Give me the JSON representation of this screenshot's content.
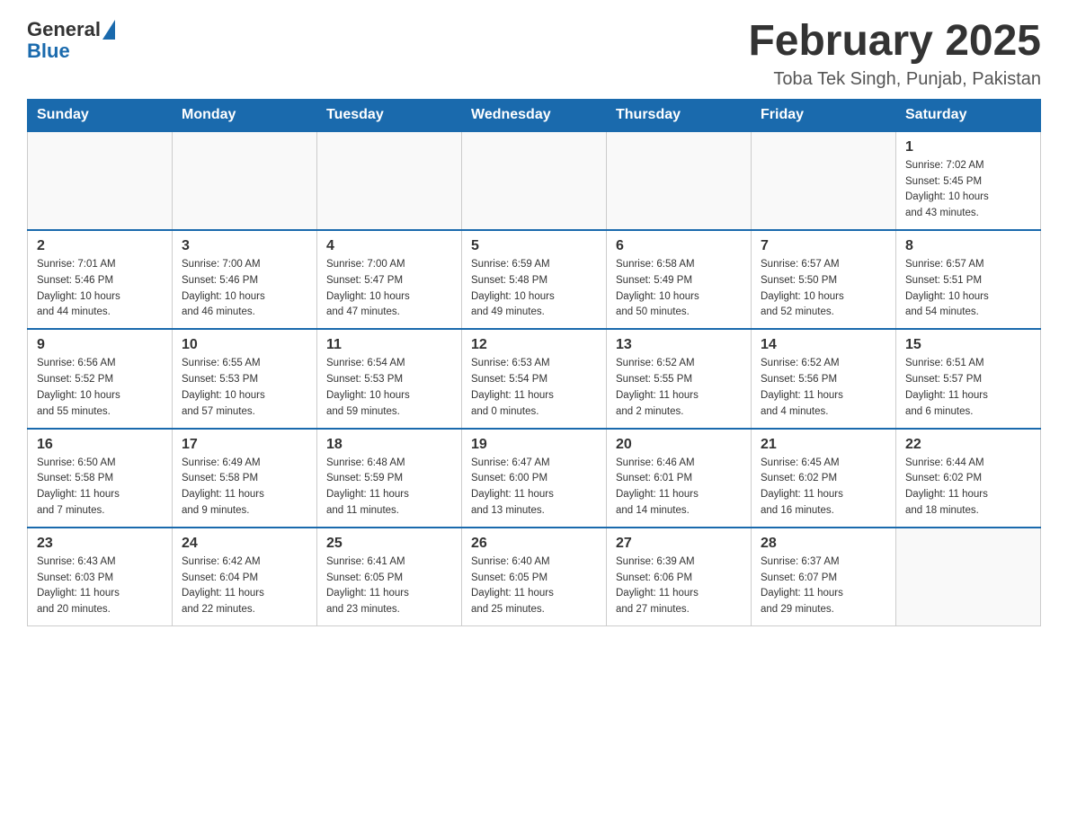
{
  "header": {
    "logo_general": "General",
    "logo_blue": "Blue",
    "title": "February 2025",
    "location": "Toba Tek Singh, Punjab, Pakistan"
  },
  "days_of_week": [
    "Sunday",
    "Monday",
    "Tuesday",
    "Wednesday",
    "Thursday",
    "Friday",
    "Saturday"
  ],
  "weeks": [
    {
      "days": [
        {
          "number": "",
          "info": ""
        },
        {
          "number": "",
          "info": ""
        },
        {
          "number": "",
          "info": ""
        },
        {
          "number": "",
          "info": ""
        },
        {
          "number": "",
          "info": ""
        },
        {
          "number": "",
          "info": ""
        },
        {
          "number": "1",
          "info": "Sunrise: 7:02 AM\nSunset: 5:45 PM\nDaylight: 10 hours\nand 43 minutes."
        }
      ]
    },
    {
      "days": [
        {
          "number": "2",
          "info": "Sunrise: 7:01 AM\nSunset: 5:46 PM\nDaylight: 10 hours\nand 44 minutes."
        },
        {
          "number": "3",
          "info": "Sunrise: 7:00 AM\nSunset: 5:46 PM\nDaylight: 10 hours\nand 46 minutes."
        },
        {
          "number": "4",
          "info": "Sunrise: 7:00 AM\nSunset: 5:47 PM\nDaylight: 10 hours\nand 47 minutes."
        },
        {
          "number": "5",
          "info": "Sunrise: 6:59 AM\nSunset: 5:48 PM\nDaylight: 10 hours\nand 49 minutes."
        },
        {
          "number": "6",
          "info": "Sunrise: 6:58 AM\nSunset: 5:49 PM\nDaylight: 10 hours\nand 50 minutes."
        },
        {
          "number": "7",
          "info": "Sunrise: 6:57 AM\nSunset: 5:50 PM\nDaylight: 10 hours\nand 52 minutes."
        },
        {
          "number": "8",
          "info": "Sunrise: 6:57 AM\nSunset: 5:51 PM\nDaylight: 10 hours\nand 54 minutes."
        }
      ]
    },
    {
      "days": [
        {
          "number": "9",
          "info": "Sunrise: 6:56 AM\nSunset: 5:52 PM\nDaylight: 10 hours\nand 55 minutes."
        },
        {
          "number": "10",
          "info": "Sunrise: 6:55 AM\nSunset: 5:53 PM\nDaylight: 10 hours\nand 57 minutes."
        },
        {
          "number": "11",
          "info": "Sunrise: 6:54 AM\nSunset: 5:53 PM\nDaylight: 10 hours\nand 59 minutes."
        },
        {
          "number": "12",
          "info": "Sunrise: 6:53 AM\nSunset: 5:54 PM\nDaylight: 11 hours\nand 0 minutes."
        },
        {
          "number": "13",
          "info": "Sunrise: 6:52 AM\nSunset: 5:55 PM\nDaylight: 11 hours\nand 2 minutes."
        },
        {
          "number": "14",
          "info": "Sunrise: 6:52 AM\nSunset: 5:56 PM\nDaylight: 11 hours\nand 4 minutes."
        },
        {
          "number": "15",
          "info": "Sunrise: 6:51 AM\nSunset: 5:57 PM\nDaylight: 11 hours\nand 6 minutes."
        }
      ]
    },
    {
      "days": [
        {
          "number": "16",
          "info": "Sunrise: 6:50 AM\nSunset: 5:58 PM\nDaylight: 11 hours\nand 7 minutes."
        },
        {
          "number": "17",
          "info": "Sunrise: 6:49 AM\nSunset: 5:58 PM\nDaylight: 11 hours\nand 9 minutes."
        },
        {
          "number": "18",
          "info": "Sunrise: 6:48 AM\nSunset: 5:59 PM\nDaylight: 11 hours\nand 11 minutes."
        },
        {
          "number": "19",
          "info": "Sunrise: 6:47 AM\nSunset: 6:00 PM\nDaylight: 11 hours\nand 13 minutes."
        },
        {
          "number": "20",
          "info": "Sunrise: 6:46 AM\nSunset: 6:01 PM\nDaylight: 11 hours\nand 14 minutes."
        },
        {
          "number": "21",
          "info": "Sunrise: 6:45 AM\nSunset: 6:02 PM\nDaylight: 11 hours\nand 16 minutes."
        },
        {
          "number": "22",
          "info": "Sunrise: 6:44 AM\nSunset: 6:02 PM\nDaylight: 11 hours\nand 18 minutes."
        }
      ]
    },
    {
      "days": [
        {
          "number": "23",
          "info": "Sunrise: 6:43 AM\nSunset: 6:03 PM\nDaylight: 11 hours\nand 20 minutes."
        },
        {
          "number": "24",
          "info": "Sunrise: 6:42 AM\nSunset: 6:04 PM\nDaylight: 11 hours\nand 22 minutes."
        },
        {
          "number": "25",
          "info": "Sunrise: 6:41 AM\nSunset: 6:05 PM\nDaylight: 11 hours\nand 23 minutes."
        },
        {
          "number": "26",
          "info": "Sunrise: 6:40 AM\nSunset: 6:05 PM\nDaylight: 11 hours\nand 25 minutes."
        },
        {
          "number": "27",
          "info": "Sunrise: 6:39 AM\nSunset: 6:06 PM\nDaylight: 11 hours\nand 27 minutes."
        },
        {
          "number": "28",
          "info": "Sunrise: 6:37 AM\nSunset: 6:07 PM\nDaylight: 11 hours\nand 29 minutes."
        },
        {
          "number": "",
          "info": ""
        }
      ]
    }
  ]
}
